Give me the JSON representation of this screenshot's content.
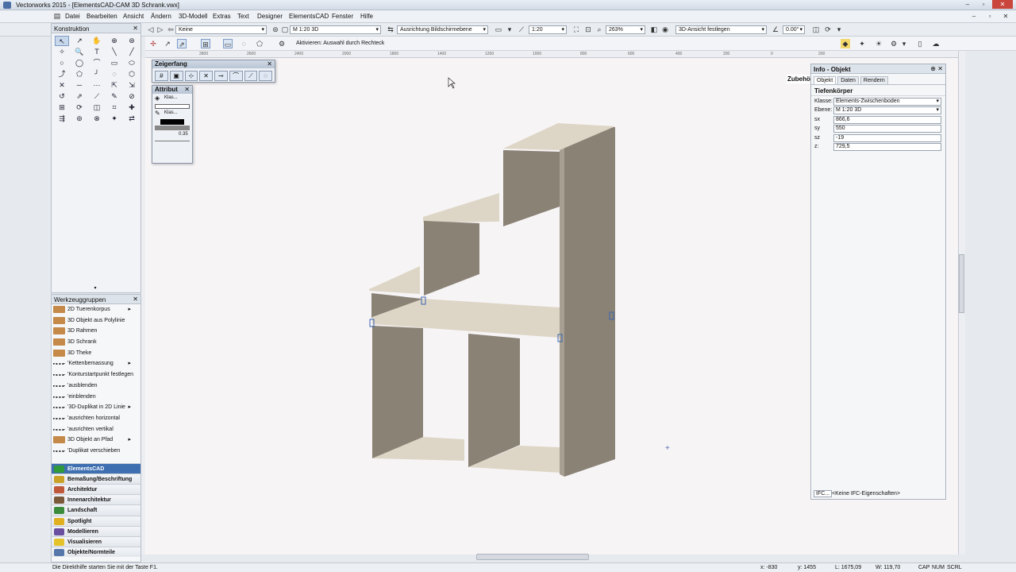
{
  "window": {
    "title": "Vectorworks 2015 - [ElementsCAD-CAM 3D Schrank.vwx]",
    "controls": [
      "–",
      "▫",
      "✕"
    ]
  },
  "menu": [
    "Datei",
    "Bearbeiten",
    "Ansicht",
    "Ändern",
    "3D-Modell",
    "Extras",
    "Text",
    "Designer",
    "ElementsCAD",
    "Fenster",
    "Hilfe"
  ],
  "toolbar": {
    "class_value": "Keine",
    "layer_value": "M 1:20 3D",
    "plane_value": "Ausrichtung Bildschirmebene",
    "scale_value": "1:20",
    "zoom_value": "263%",
    "view_value": "3D-Ansicht festlegen",
    "angle_value": "0.00°"
  },
  "mode_bar": {
    "hint": "Aktivieren: Auswahl durch Rechteck"
  },
  "ruler_labels": [
    "2800",
    "2600",
    "2400",
    "2000",
    "1800",
    "1400",
    "1200",
    "1000",
    "800",
    "600",
    "400",
    "200",
    "0",
    "200"
  ],
  "construction_panel": {
    "title": "Konstruktion",
    "tools": [
      "↖",
      "↗",
      "✋",
      "⊕",
      "⊛",
      "✧",
      "🔍",
      "T",
      "╲",
      "╱",
      "○",
      "◯",
      "⌒",
      "▭",
      "⬭",
      "⤴",
      "⬠",
      "╯",
      "◌",
      "⬡",
      "✕",
      "─",
      "⋯",
      "⇱",
      "⇲",
      "↺",
      "⇗",
      "⟋",
      "✎",
      "⊘",
      "⊞",
      "⟳",
      "◫",
      "⌗",
      "✚",
      "⇶",
      "⊚",
      "⊗",
      "✦",
      "⇄"
    ]
  },
  "tool_sets_panel": {
    "title": "Werkzeuggruppen",
    "items": [
      {
        "label": "2D Tuerenkorpus",
        "arrow": "▸"
      },
      {
        "label": "3D Objekt aus Polylinie",
        "arrow": ""
      },
      {
        "label": "3D Rahmen",
        "arrow": ""
      },
      {
        "label": "3D Schrank",
        "arrow": ""
      },
      {
        "label": "3D Theke",
        "arrow": ""
      },
      {
        "label": "'Kettenbemassung",
        "arrow": "▸"
      },
      {
        "label": "'Konturstartpunkt festlegen",
        "arrow": ""
      },
      {
        "label": "'ausblenden",
        "arrow": ""
      },
      {
        "label": "'einblenden",
        "arrow": ""
      },
      {
        "label": "'3D-Duplikat in 2D Linie",
        "arrow": "▸"
      },
      {
        "label": "'ausrichten horizontal",
        "arrow": ""
      },
      {
        "label": "'ausrichten vertikal",
        "arrow": ""
      },
      {
        "label": "3D Objekt an Pfad",
        "arrow": "▸"
      },
      {
        "label": "'Duplikat verschieben",
        "arrow": ""
      }
    ],
    "sets": [
      {
        "label": "ElementsCAD",
        "color": "#2f9a3a"
      },
      {
        "label": "Bemaßung/Beschriftung",
        "color": "#c9a227"
      },
      {
        "label": "Architektur",
        "color": "#c0583a"
      },
      {
        "label": "Innenarchitektur",
        "color": "#7a5a3a"
      },
      {
        "label": "Landschaft",
        "color": "#3b8c3b"
      },
      {
        "label": "Spotlight",
        "color": "#e0b020"
      },
      {
        "label": "Modellieren",
        "color": "#6a4fa0"
      },
      {
        "label": "Visualisieren",
        "color": "#e3c22a"
      },
      {
        "label": "Objekte/Normteile",
        "color": "#5577aa"
      }
    ]
  },
  "snap_palette": {
    "title": "Zeigerfang",
    "buttons": [
      "#",
      "▣",
      "⊹",
      "✕",
      "⊸",
      "⌒",
      "⟋",
      "◌"
    ]
  },
  "attribute_palette": {
    "title": "Attribut",
    "fill_label": "Klas...",
    "pen_label": "Klas...",
    "line_weight": "0.35"
  },
  "info_panel": {
    "title": "Info - Objekt",
    "tabs": [
      "Objekt",
      "Daten",
      "Rendern"
    ],
    "object_type": "Tiefenkörper",
    "fields": [
      {
        "label": "Klasse:",
        "value": "Elements-Zwischenboden",
        "dropdown": true
      },
      {
        "label": "Ebene:",
        "value": "M 1:20 3D",
        "dropdown": true
      },
      {
        "label": "sx",
        "value": "866,6",
        "dropdown": false
      },
      {
        "label": "sy",
        "value": "550",
        "dropdown": false
      },
      {
        "label": "sz",
        "value": "-19",
        "dropdown": false
      },
      {
        "label": "z:",
        "value": "729,5",
        "dropdown": false
      }
    ],
    "ifc_button": "IFC...",
    "ifc_text": "<Keine IFC-Eigenschaften>"
  },
  "accessory_label": "Zubehö",
  "status_bar": {
    "help": "Die Direkthilfe starten Sie mit der Taste F1.",
    "x": "x: -830",
    "y": "y: 1455",
    "length": "L: 1675,09",
    "angle": "W: 119,70",
    "caps": "CAP",
    "num": "NUM",
    "scrl": "SCRL"
  },
  "colors": {
    "board_dark": "#8a8275",
    "board_side": "#a79f92",
    "board_light": "#ddd6c6",
    "handle": "#3a64b0"
  }
}
